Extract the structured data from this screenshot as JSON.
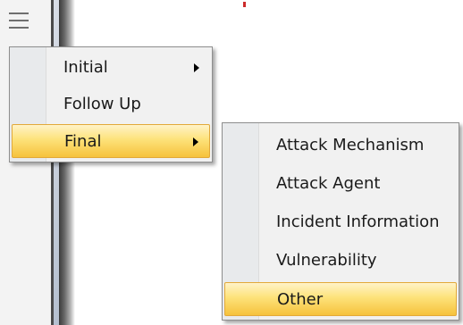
{
  "background": {
    "menu_icon": "hamburger-icon",
    "accent_red": "#cc2a2a"
  },
  "context_menu": {
    "items": [
      {
        "label": "Initial",
        "has_submenu": true,
        "highlighted": false
      },
      {
        "label": "Follow Up",
        "has_submenu": false,
        "highlighted": false
      },
      {
        "label": "Final",
        "has_submenu": true,
        "highlighted": true
      }
    ]
  },
  "submenu": {
    "items": [
      {
        "label": "Attack Mechanism",
        "highlighted": false
      },
      {
        "label": "Attack Agent",
        "highlighted": false
      },
      {
        "label": "Incident Information",
        "highlighted": false
      },
      {
        "label": "Vulnerability",
        "highlighted": false
      },
      {
        "label": "Other",
        "highlighted": true
      }
    ]
  },
  "colors": {
    "highlight_top": "#fff3c8",
    "highlight_bottom": "#f6c23c",
    "highlight_border": "#e2a93a",
    "menu_bg": "#f1f1f1"
  }
}
